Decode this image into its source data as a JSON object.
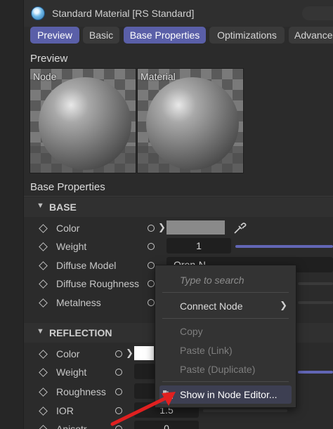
{
  "window": {
    "title": "Standard Material [RS Standard]"
  },
  "tabs": [
    {
      "label": "Preview",
      "active": true
    },
    {
      "label": "Basic",
      "active": false
    },
    {
      "label": "Base Properties",
      "active": true
    },
    {
      "label": "Optimizations",
      "active": false
    },
    {
      "label": "Advance",
      "active": false
    }
  ],
  "preview": {
    "heading": "Preview",
    "panels": [
      {
        "label": "Node"
      },
      {
        "label": "Material"
      }
    ]
  },
  "base_properties": {
    "heading": "Base Properties",
    "group_title": "BASE",
    "rows": [
      {
        "label": "Color",
        "swatch": "#8a8a8a"
      },
      {
        "label": "Weight",
        "value": "1"
      },
      {
        "label": "Diffuse Model",
        "value": "Oren-N"
      },
      {
        "label": "Diffuse Roughness",
        "value": ""
      },
      {
        "label": "Metalness",
        "value": ""
      }
    ]
  },
  "reflection": {
    "group_title": "REFLECTION",
    "rows": [
      {
        "label": "Color",
        "swatch": "#ffffff"
      },
      {
        "label": "Weight",
        "value": ""
      },
      {
        "label": "Roughness",
        "value": ""
      },
      {
        "label": "IOR",
        "value": "1.5"
      },
      {
        "label": "Anisotr",
        "value": "0"
      }
    ]
  },
  "context_menu": {
    "search_placeholder": "Type to search",
    "connect_node": "Connect Node",
    "copy": "Copy",
    "paste_link": "Paste (Link)",
    "paste_duplicate": "Paste (Duplicate)",
    "show_in_node_editor": "Show in Node Editor..."
  },
  "colors": {
    "accent": "#5a5fa8",
    "annotation_arrow": "#e02020"
  }
}
